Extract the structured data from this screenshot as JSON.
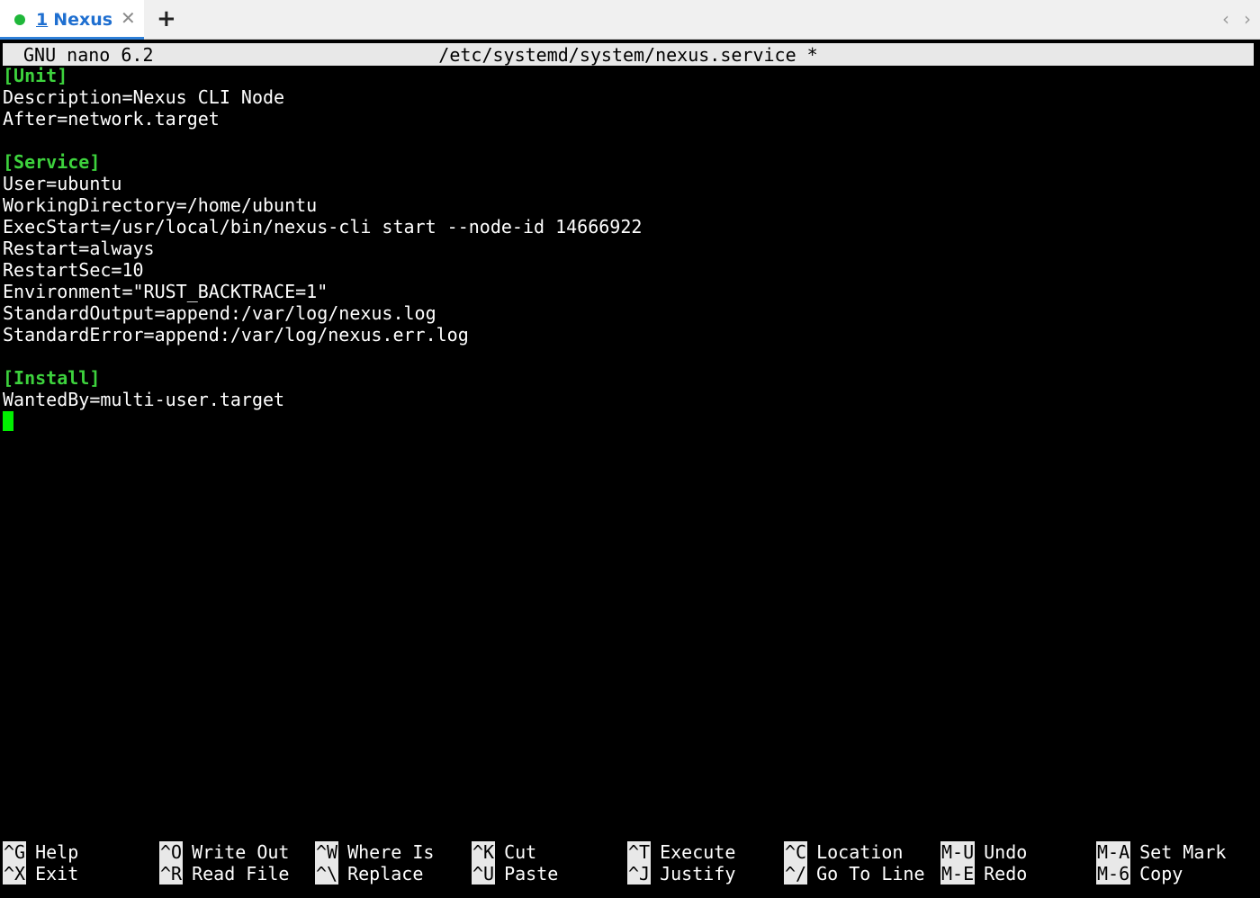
{
  "tabbar": {
    "tab": {
      "number": "1",
      "title": "Nexus",
      "status_color": "#1fb73a",
      "title_color": "#1f6fd0"
    },
    "close_glyph": "✕",
    "new_tab_glyph": "+",
    "scroll_left_glyph": "‹",
    "scroll_right_glyph": "›"
  },
  "editor": {
    "app": "GNU nano 6.2",
    "file": "/etc/systemd/system/nexus.service *",
    "section_color": "#3dd23d",
    "cursor_color": "#00f000",
    "lines": [
      {
        "text": "[Unit]",
        "section": true
      },
      {
        "text": "Description=Nexus CLI Node",
        "section": false
      },
      {
        "text": "After=network.target",
        "section": false
      },
      {
        "text": "",
        "section": false
      },
      {
        "text": "[Service]",
        "section": true
      },
      {
        "text": "User=ubuntu",
        "section": false
      },
      {
        "text": "WorkingDirectory=/home/ubuntu",
        "section": false
      },
      {
        "text": "ExecStart=/usr/local/bin/nexus-cli start --node-id 14666922",
        "section": false
      },
      {
        "text": "Restart=always",
        "section": false
      },
      {
        "text": "RestartSec=10",
        "section": false
      },
      {
        "text": "Environment=\"RUST_BACKTRACE=1\"",
        "section": false
      },
      {
        "text": "StandardOutput=append:/var/log/nexus.log",
        "section": false
      },
      {
        "text": "StandardError=append:/var/log/nexus.err.log",
        "section": false
      },
      {
        "text": "",
        "section": false
      },
      {
        "text": "[Install]",
        "section": true
      },
      {
        "text": "WantedBy=multi-user.target",
        "section": false
      }
    ]
  },
  "shortcuts": {
    "row1": [
      {
        "key": "^G",
        "label": "Help"
      },
      {
        "key": "^O",
        "label": "Write Out"
      },
      {
        "key": "^W",
        "label": "Where Is"
      },
      {
        "key": "^K",
        "label": "Cut"
      },
      {
        "key": "^T",
        "label": "Execute"
      },
      {
        "key": "^C",
        "label": "Location"
      },
      {
        "key": "M-U",
        "label": "Undo"
      },
      {
        "key": "M-A",
        "label": "Set Mark"
      }
    ],
    "row2": [
      {
        "key": "^X",
        "label": "Exit"
      },
      {
        "key": "^R",
        "label": "Read File"
      },
      {
        "key": "^\\",
        "label": "Replace"
      },
      {
        "key": "^U",
        "label": "Paste"
      },
      {
        "key": "^J",
        "label": "Justify"
      },
      {
        "key": "^/",
        "label": "Go To Line"
      },
      {
        "key": "M-E",
        "label": "Redo"
      },
      {
        "key": "M-6",
        "label": "Copy"
      }
    ]
  }
}
